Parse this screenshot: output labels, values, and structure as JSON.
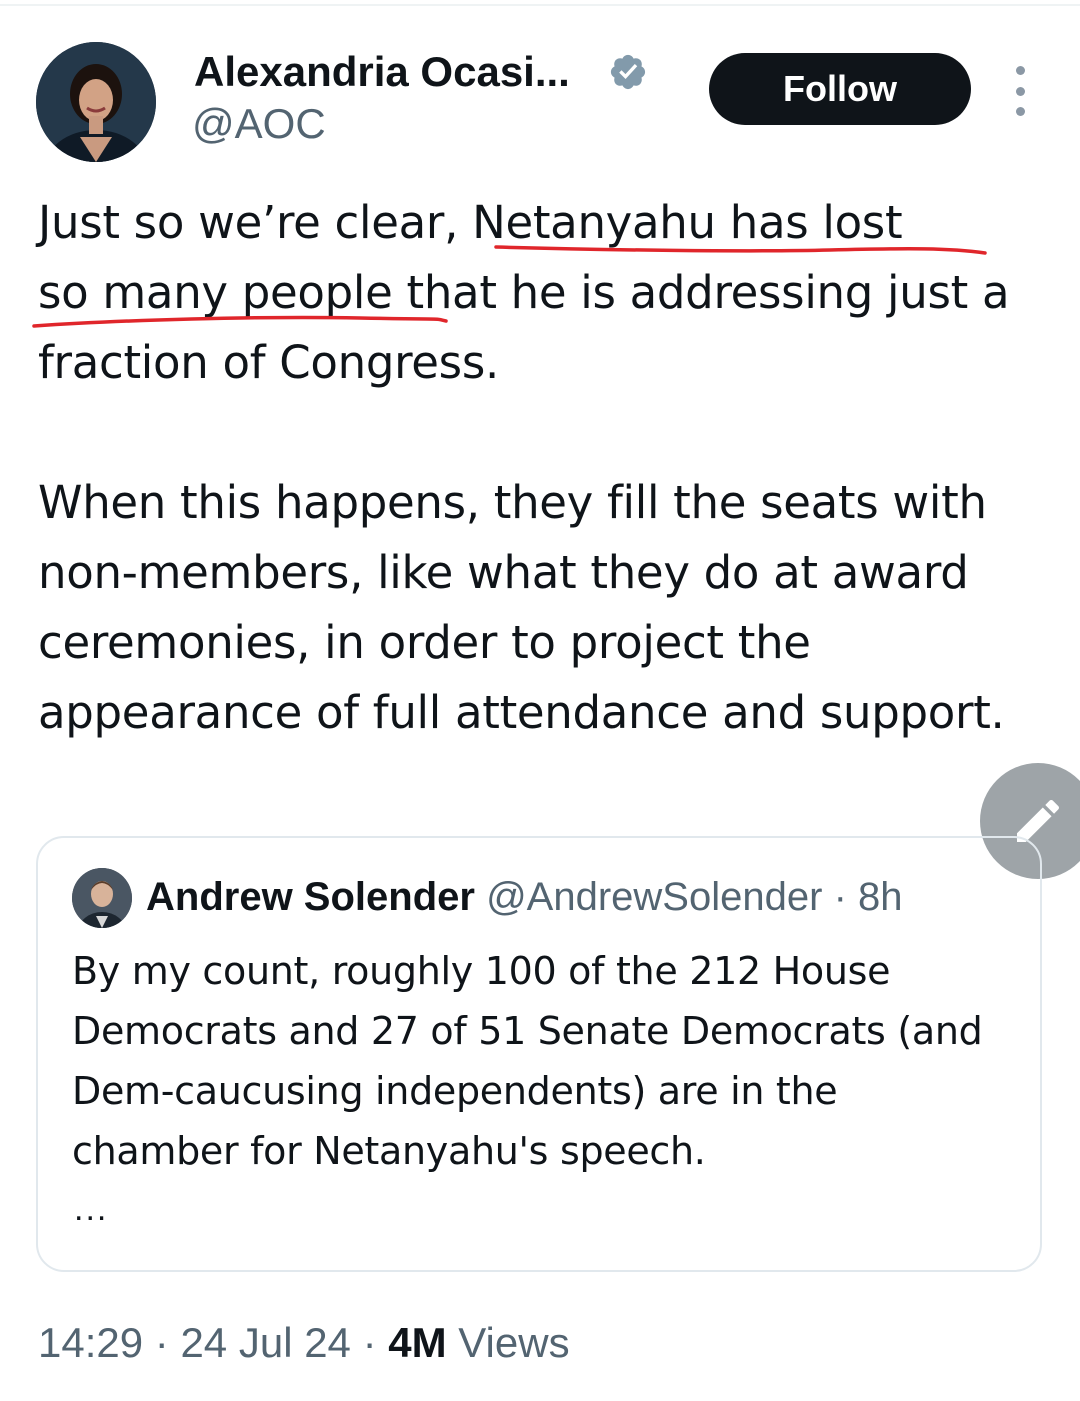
{
  "author": {
    "display_name": "Alexandria Ocasi...",
    "handle": "@AOC",
    "verified": true
  },
  "follow_button": {
    "label": "Follow"
  },
  "tweet": {
    "paragraph_1": {
      "part_1": "Just so we’re clear, ",
      "underlined_1": "Netanyahu has lost",
      "line_break_text": "",
      "underlined_2": "so many people",
      "part_2": " that he is addressing just a fraction of Congress."
    },
    "paragraph_2": "When this happens, they fill the seats with non-members, like what they do at award ceremonies, in order to project the appearance of full attendance and support."
  },
  "quoted_tweet": {
    "display_name": "Andrew Solender",
    "handle": "@AndrewSolender",
    "separator": "·",
    "time": "8h",
    "text": "By my count, roughly 100 of the 212 House Democrats and 27 of 51 Senate Democrats (and Dem-caucusing independents) are in the chamber for Netanyahu's speech.",
    "more": "..."
  },
  "meta": {
    "time": "14:29",
    "separator": "·",
    "date": "24 Jul 24",
    "views_count": "4M",
    "views_label": "Views"
  },
  "colors": {
    "primary_text": "#0f1419",
    "secondary_text": "#536471",
    "verified_badge": "#829aab",
    "annotation_underline": "#e0262b",
    "compose_fab": "#9ea4a8"
  }
}
